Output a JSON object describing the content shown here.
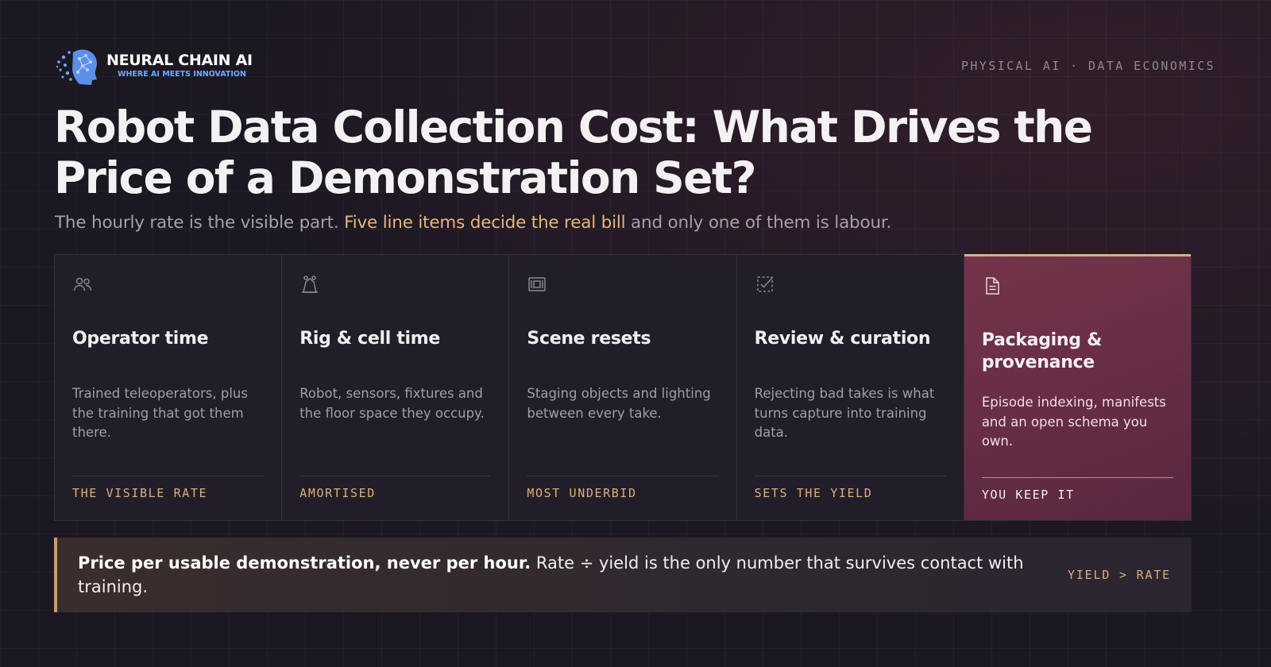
{
  "brand": {
    "name": "NEURAL CHAIN AI",
    "tagline": "WHERE AI MEETS INNOVATION",
    "logo_icon": "brain-head-icon"
  },
  "kicker": "PHYSICAL AI · DATA ECONOMICS",
  "title": "Robot Data Collection Cost: What Drives the Price of a Demonstration Set?",
  "subtitle": {
    "before": "The hourly rate is the visible part. ",
    "highlight": "Five line items decide the real bill",
    "after": " and only one of them is labour."
  },
  "cards": [
    {
      "icon": "people-icon",
      "title": "Operator time",
      "desc": "Trained teleoperators, plus the training that got them there.",
      "tag": "THE VISIBLE RATE"
    },
    {
      "icon": "robot-arm-icon",
      "title": "Rig & cell time",
      "desc": "Robot, sensors, fixtures and the floor space they occupy.",
      "tag": "AMORTISED"
    },
    {
      "icon": "scene-frame-icon",
      "title": "Scene resets",
      "desc": "Staging objects and lighting between every take.",
      "tag": "MOST UNDERBID"
    },
    {
      "icon": "checkbox-icon",
      "title": "Review & curation",
      "desc": "Rejecting bad takes is what turns capture into training data.",
      "tag": "SETS THE YIELD"
    },
    {
      "icon": "document-icon",
      "title": "Packaging & provenance",
      "desc": "Episode indexing, manifests and an open schema you own.",
      "tag": "YOU KEEP IT"
    }
  ],
  "footer": {
    "bold": "Price per usable demonstration, never per hour.",
    "text": " Rate ÷ yield is the only number that survives contact with training.",
    "tag": "YIELD > RATE"
  },
  "colors": {
    "background": "#1c1822",
    "accent_gold": "#dcae78",
    "featured_card": "#6a2f46",
    "brand_blue": "#6fa8ff"
  }
}
